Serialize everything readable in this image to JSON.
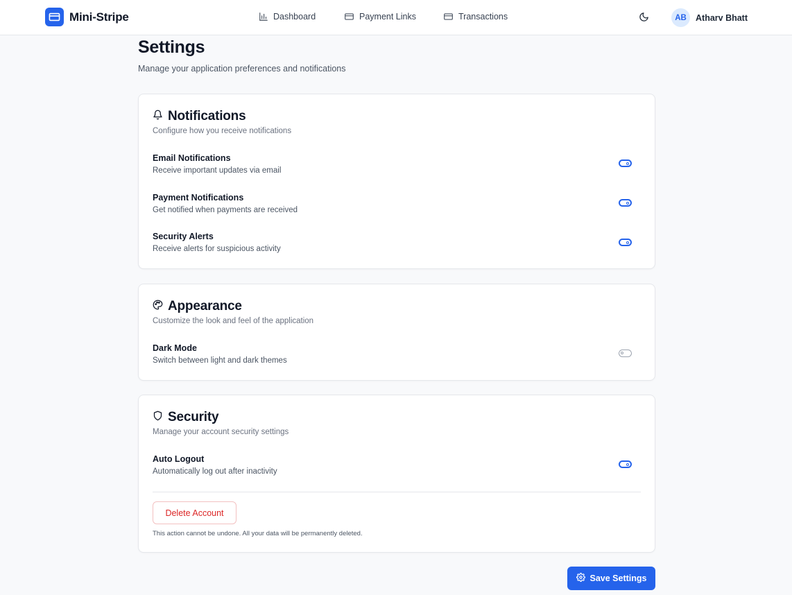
{
  "app": {
    "name": "Mini-Stripe"
  },
  "nav": {
    "links": [
      {
        "label": "Dashboard",
        "icon": "bar-chart-icon"
      },
      {
        "label": "Payment Links",
        "icon": "credit-card-icon"
      },
      {
        "label": "Transactions",
        "icon": "credit-card-icon"
      }
    ],
    "theme_toggle_icon": "moon-icon",
    "user": {
      "initials": "AB",
      "name": "Atharv Bhatt"
    }
  },
  "page": {
    "title": "Settings",
    "subtitle": "Manage your application preferences and notifications"
  },
  "sections": {
    "notifications": {
      "icon": "bell-icon",
      "title": "Notifications",
      "description": "Configure how you receive notifications",
      "items": [
        {
          "title": "Email Notifications",
          "description": "Receive important updates via email",
          "enabled": true
        },
        {
          "title": "Payment Notifications",
          "description": "Get notified when payments are received",
          "enabled": true
        },
        {
          "title": "Security Alerts",
          "description": "Receive alerts for suspicious activity",
          "enabled": true
        }
      ]
    },
    "appearance": {
      "icon": "palette-icon",
      "title": "Appearance",
      "description": "Customize the look and feel of the application",
      "items": [
        {
          "title": "Dark Mode",
          "description": "Switch between light and dark themes",
          "enabled": false
        }
      ]
    },
    "security": {
      "icon": "shield-icon",
      "title": "Security",
      "description": "Manage your account security settings",
      "items": [
        {
          "title": "Auto Logout",
          "description": "Automatically log out after inactivity",
          "enabled": true
        }
      ],
      "delete_label": "Delete Account",
      "delete_note": "This action cannot be undone. All your data will be permanently deleted."
    }
  },
  "actions": {
    "save_label": "Save Settings",
    "save_icon": "gear-icon"
  },
  "colors": {
    "accent": "#2563eb",
    "danger": "#dc2626",
    "toggle_off": "#9ca3af"
  }
}
